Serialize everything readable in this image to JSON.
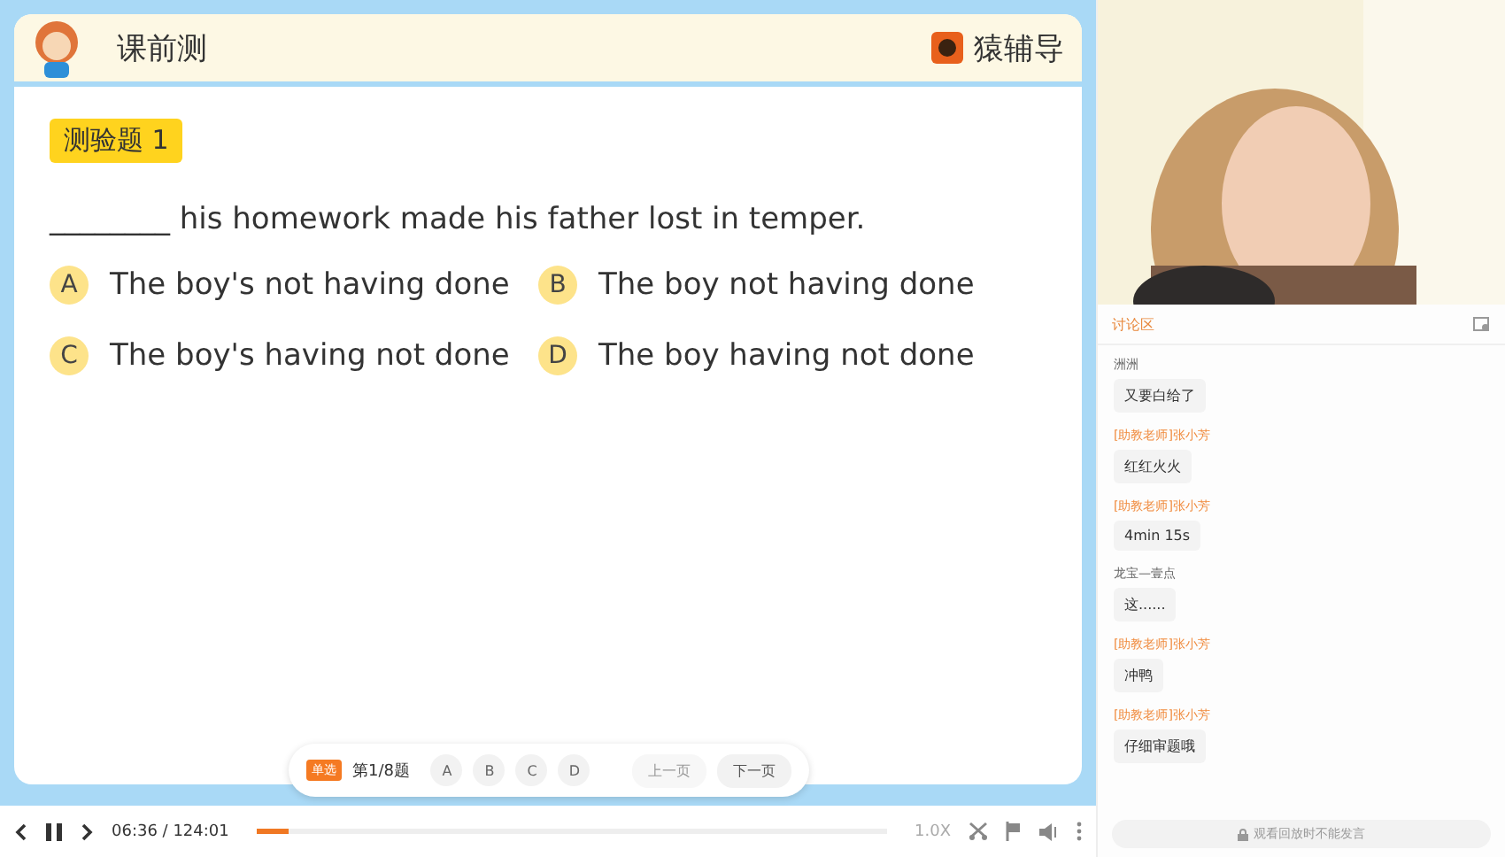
{
  "header": {
    "title": "课前测",
    "brand": "猿辅导"
  },
  "question": {
    "tag": "测验题 1",
    "text": "________ his homework made his father lost in temper.",
    "options": [
      {
        "letter": "A",
        "text": "The boy's not having done"
      },
      {
        "letter": "B",
        "text": "The boy not having done"
      },
      {
        "letter": "C",
        "text": "The boy's having not done"
      },
      {
        "letter": "D",
        "text": "The boy having not done"
      }
    ]
  },
  "answer_bar": {
    "type_badge": "单选",
    "progress": "第1/8题",
    "choices": [
      {
        "label": "A",
        "selected": false
      },
      {
        "label": "B",
        "selected": false
      },
      {
        "label": "C",
        "selected": false
      },
      {
        "label": "D",
        "selected": false
      }
    ],
    "prev": {
      "label": "上一页",
      "disabled": true
    },
    "next": {
      "label": "下一页",
      "disabled": false
    }
  },
  "player": {
    "time": "06:36 / 124:01",
    "level": 0.05,
    "speed": "1.0X"
  },
  "chat": {
    "title": "讨论区",
    "messages": [
      {
        "sender": "洲洲",
        "kind": "student",
        "text": "又要白给了"
      },
      {
        "sender": "[助教老师]张小芳",
        "kind": "teacher",
        "text": "红红火火"
      },
      {
        "sender": "[助教老师]张小芳",
        "kind": "teacher",
        "text": "4min 15s"
      },
      {
        "sender": "龙宝—壹点",
        "kind": "student",
        "text": "这......"
      },
      {
        "sender": "[助教老师]张小芳",
        "kind": "teacher",
        "text": "冲鸭"
      },
      {
        "sender": "[助教老师]张小芳",
        "kind": "teacher",
        "text": "仔细审题哦"
      }
    ],
    "input_placeholder": "观看回放时不能发言"
  }
}
